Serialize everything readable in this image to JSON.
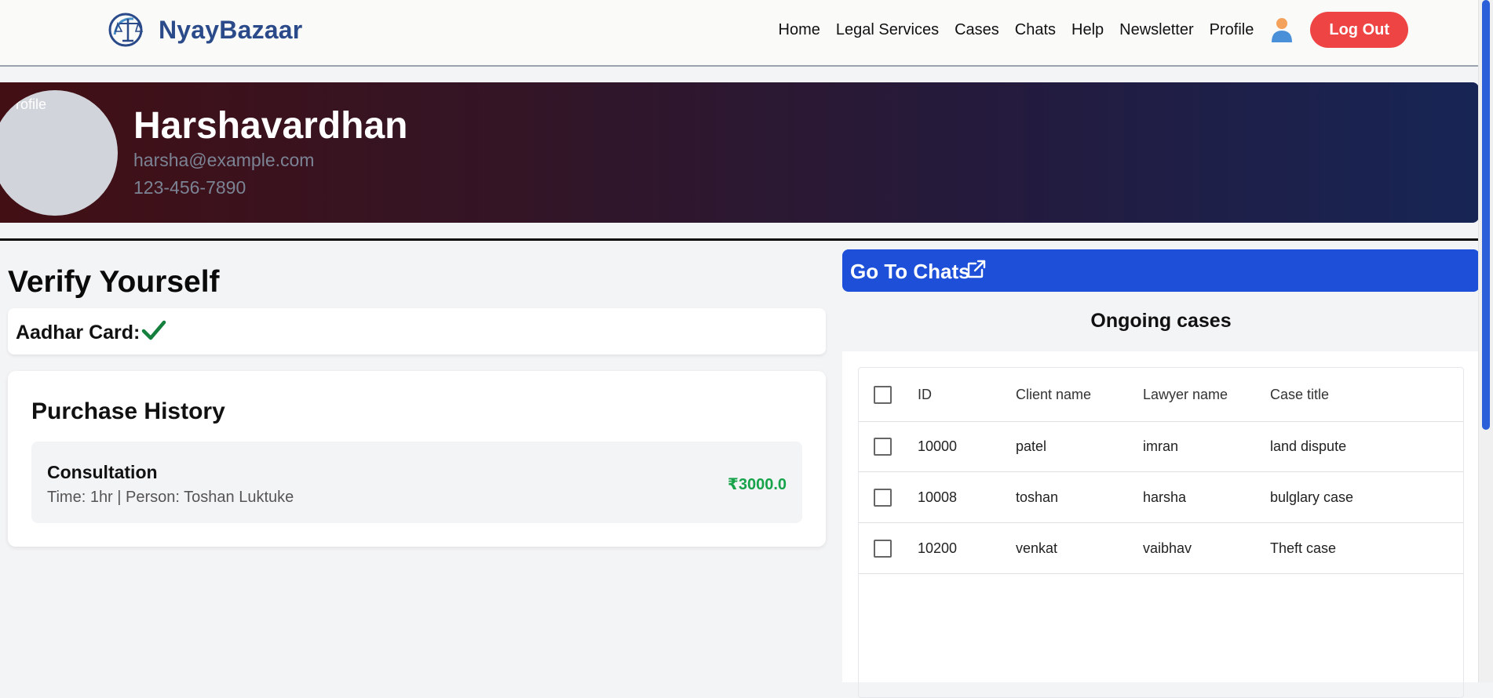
{
  "nav": {
    "brand": "NyayBazaar",
    "links": [
      "Home",
      "Legal Services",
      "Cases",
      "Chats",
      "Help",
      "Newsletter",
      "Profile"
    ],
    "logout_label": "Log Out"
  },
  "profile": {
    "avatar_alt": "rofile",
    "name": "Harshavardhan",
    "email": "harsha@example.com",
    "phone": "123-456-7890"
  },
  "verify": {
    "title": "Verify Yourself",
    "aadhar_label": "Aadhar Card:",
    "aadhar_status_icon": "check-icon"
  },
  "purchase": {
    "title": "Purchase History",
    "items": [
      {
        "title": "Consultation",
        "meta": "Time: 1hr | Person: Toshan Luktuke",
        "price": "₹3000.0"
      }
    ]
  },
  "chats": {
    "label": "Go To Chats",
    "icon": "external-link-icon"
  },
  "cases": {
    "title": "Ongoing cases",
    "columns": [
      "ID",
      "Client name",
      "Lawyer name",
      "Case title"
    ],
    "rows": [
      [
        "10000",
        "patel",
        "imran",
        "land dispute"
      ],
      [
        "10008",
        "toshan",
        "harsha",
        "bulglary case"
      ],
      [
        "10200",
        "venkat",
        "vaibhav",
        "Theft case"
      ]
    ]
  },
  "colors": {
    "brand": "#2a4a8a",
    "logout": "#ef4444",
    "chats_button": "#1d4fd8",
    "price": "#16a34a",
    "check": "#15803d"
  }
}
